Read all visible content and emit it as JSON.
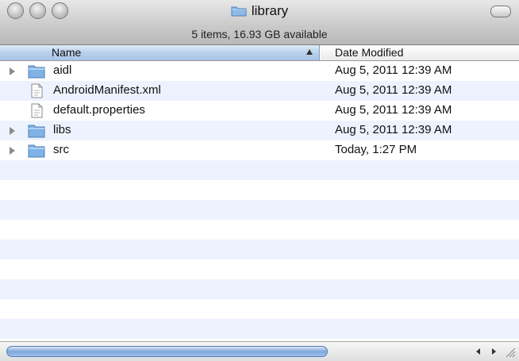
{
  "window": {
    "title": "library",
    "status": "5 items, 16.93 GB available"
  },
  "columns": {
    "name": "Name",
    "date_modified": "Date Modified",
    "sort_indicator": "ascending"
  },
  "files": [
    {
      "name": "aidl",
      "date": "Aug 5, 2011 12:39 AM",
      "kind": "folder",
      "icon": "folder-icon"
    },
    {
      "name": "AndroidManifest.xml",
      "date": "Aug 5, 2011 12:39 AM",
      "kind": "file",
      "icon": "document-icon"
    },
    {
      "name": "default.properties",
      "date": "Aug 5, 2011 12:39 AM",
      "kind": "file",
      "icon": "document-icon"
    },
    {
      "name": "libs",
      "date": "Aug 5, 2011 12:39 AM",
      "kind": "folder",
      "icon": "folder-icon"
    },
    {
      "name": "src",
      "date": "Today, 1:27 PM",
      "kind": "folder",
      "icon": "folder-icon"
    }
  ],
  "colors": {
    "stripe": "#edf3fe",
    "folder": "#7fb2e5",
    "header_selected": "#b9d0ec"
  }
}
